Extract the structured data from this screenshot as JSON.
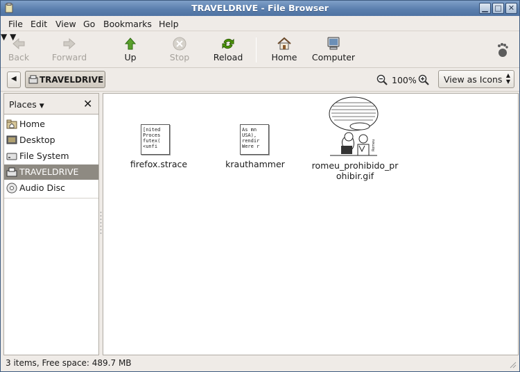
{
  "window": {
    "title": "TRAVELDRIVE - File Browser"
  },
  "menu": [
    "File",
    "Edit",
    "View",
    "Go",
    "Bookmarks",
    "Help"
  ],
  "toolbar": {
    "back": "Back",
    "forward": "Forward",
    "up": "Up",
    "stop": "Stop",
    "reload": "Reload",
    "home": "Home",
    "computer": "Computer"
  },
  "location": {
    "path_button": "TRAVELDRIVE",
    "zoom": "100%",
    "view_mode": "View as Icons"
  },
  "sidebar": {
    "header": "Places",
    "items": [
      {
        "label": "Home",
        "icon": "home-folder-icon"
      },
      {
        "label": "Desktop",
        "icon": "desktop-icon"
      },
      {
        "label": "File System",
        "icon": "drive-icon"
      },
      {
        "label": "TRAVELDRIVE",
        "icon": "usb-drive-icon",
        "selected": true
      },
      {
        "label": "Audio Disc",
        "icon": "cd-icon"
      }
    ]
  },
  "files": [
    {
      "name": "firefox.strace",
      "preview": [
        "[nited",
        "Proces",
        "futex(",
        "<unfi"
      ]
    },
    {
      "name": "krauthammer",
      "preview": [
        "As mn",
        "USA),",
        "rendir",
        "Were r"
      ]
    },
    {
      "name_line1": "romeu_prohibido_pr",
      "name_line2": "ohibir.gif",
      "preview_text": "DETRAS DE LA LEY DEL PRO HIBIDO PROHIBIR"
    }
  ],
  "status": "3 items, Free space: 489.7 MB"
}
